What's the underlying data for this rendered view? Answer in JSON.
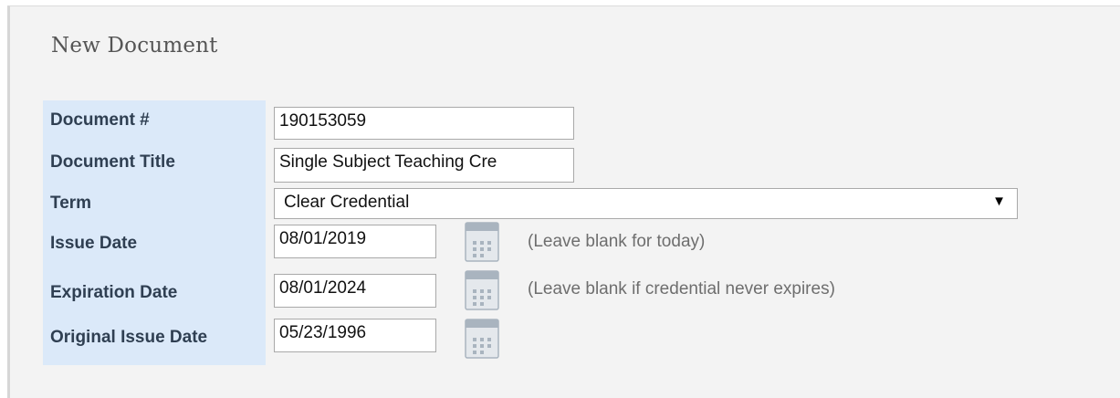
{
  "form": {
    "title": "New Document",
    "document_number": {
      "label": "Document #",
      "value": "190153059"
    },
    "document_title": {
      "label": "Document Title",
      "value": "Single Subject Teaching Cre"
    },
    "term": {
      "label": "Term",
      "selected": "Clear Credential",
      "arrow": "▼"
    },
    "issue_date": {
      "label": "Issue Date",
      "value": "08/01/2019",
      "hint": "(Leave blank for today)"
    },
    "expiration_date": {
      "label": "Expiration Date",
      "value": "08/01/2024",
      "hint": "(Leave blank if credential never expires)"
    },
    "original_issue_date": {
      "label": "Original Issue Date",
      "value": "05/23/1996"
    }
  },
  "icons": {
    "calendar": "calendar-icon"
  },
  "colors": {
    "panel_bg": "#f3f3f3",
    "label_column_bg": "#dbe9f9",
    "label_text": "#2f3f52",
    "hint_text": "#6e6e6e",
    "title_text": "#555555",
    "calendar_icon": "#a9b4bf"
  }
}
